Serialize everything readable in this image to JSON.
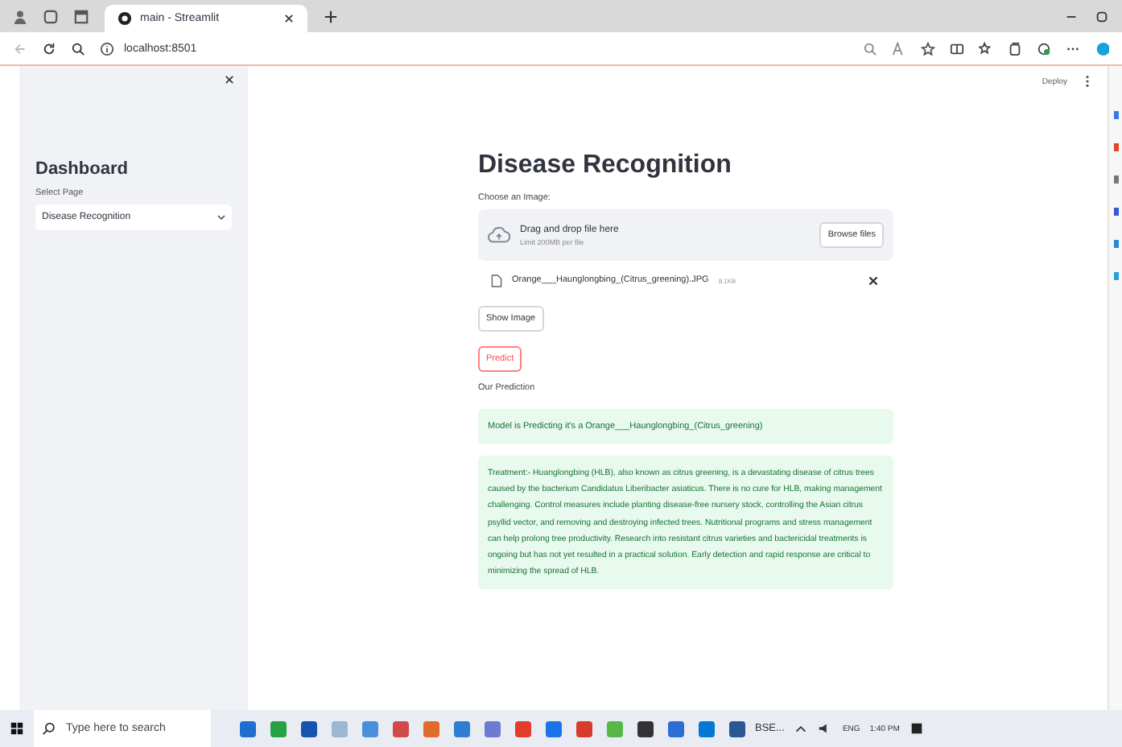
{
  "browser": {
    "tab_title": "main - Streamlit",
    "address": "localhost:8501"
  },
  "header": {
    "deploy": "Deploy"
  },
  "sidebar": {
    "title": "Dashboard",
    "select_label": "Select Page",
    "select_value": "Disease Recognition"
  },
  "main": {
    "title": "Disease Recognition",
    "uploader_label": "Choose an Image:",
    "drop_text": "Drag and drop file here",
    "limit_text": "Limit 200MB per file",
    "browse_button": "Browse files",
    "file": {
      "name": "Orange___Haunglongbing_(Citrus_greening).JPG",
      "size": "8.1KB"
    },
    "show_button": "Show Image",
    "predict_button": "Predict",
    "prediction_label": "Our Prediction",
    "prediction": "Model is Predicting it's a Orange___Haunglongbing_(Citrus_greening)",
    "treatment": "Treatment:- Huanglongbing (HLB), also known as citrus greening, is a devastating disease of citrus trees caused by the bacterium Candidatus Liberibacter asiaticus. There is no cure for HLB, making management challenging. Control measures include planting disease-free nursery stock, controlling the Asian citrus psyllid vector, and removing and destroying infected trees. Nutritional programs and stress management can help prolong tree productivity. Research into resistant citrus varieties and bactericidal treatments is ongoing but has not yet resulted in a practical solution. Early detection and rapid response are critical to minimizing the spread of HLB."
  },
  "taskbar": {
    "search_placeholder": "Type here to search",
    "app_label": "BSE...",
    "language": "ENG",
    "time": "1:40 PM"
  }
}
